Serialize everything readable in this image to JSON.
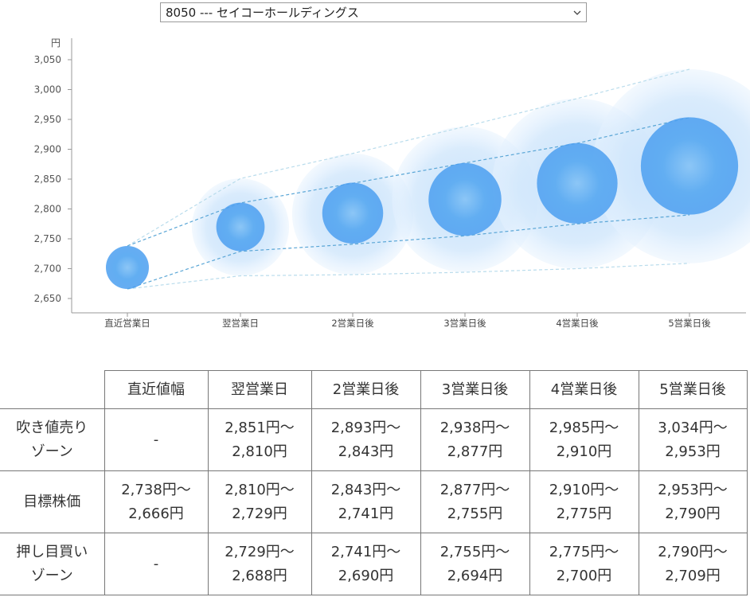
{
  "selector": {
    "selected": "8050 --- セイコーホールディングス",
    "icon": "chevron-down-icon"
  },
  "chart_data": {
    "type": "bubble",
    "ylabel": "円",
    "ylim": [
      2650,
      3050
    ],
    "yticks": [
      "3,050",
      "3,000",
      "2,950",
      "2,900",
      "2,850",
      "2,800",
      "2,750",
      "2,700",
      "2,650"
    ],
    "ytick_values": [
      3050,
      3000,
      2950,
      2900,
      2850,
      2800,
      2750,
      2700,
      2650
    ],
    "categories": [
      "直近営業日",
      "翌営業日",
      "2営業日後",
      "3営業日後",
      "4営業日後",
      "5営業日後"
    ],
    "target_center": [
      2702,
      2770,
      2793,
      2816,
      2843,
      2872
    ],
    "target_upper": [
      2738,
      2810,
      2843,
      2877,
      2910,
      2953
    ],
    "target_lower": [
      2666,
      2729,
      2741,
      2755,
      2775,
      2790
    ],
    "sell_zone_upper": [
      null,
      2851,
      2893,
      2938,
      2985,
      3034
    ],
    "buy_zone_lower": [
      null,
      2688,
      2690,
      2694,
      2700,
      2709
    ],
    "colors": {
      "bubble": "#5aaaf0",
      "halo": "#c8e2fb",
      "dash_inner": "#5aa6d6",
      "dash_outer": "#b9dcec",
      "axis": "#999999"
    }
  },
  "table": {
    "headers": [
      "",
      "直近値幅",
      "翌営業日",
      "2営業日後",
      "3営業日後",
      "4営業日後",
      "5営業日後"
    ],
    "rows": [
      {
        "label": [
          "吹き値売り",
          "ゾーン"
        ],
        "cells": [
          [
            "-"
          ],
          [
            "2,851円～",
            "2,810円"
          ],
          [
            "2,893円～",
            "2,843円"
          ],
          [
            "2,938円～",
            "2,877円"
          ],
          [
            "2,985円～",
            "2,910円"
          ],
          [
            "3,034円～",
            "2,953円"
          ]
        ]
      },
      {
        "label": [
          "目標株価"
        ],
        "cells": [
          [
            "2,738円～",
            "2,666円"
          ],
          [
            "2,810円～",
            "2,729円"
          ],
          [
            "2,843円～",
            "2,741円"
          ],
          [
            "2,877円～",
            "2,755円"
          ],
          [
            "2,910円～",
            "2,775円"
          ],
          [
            "2,953円～",
            "2,790円"
          ]
        ]
      },
      {
        "label": [
          "押し目買い",
          "ゾーン"
        ],
        "cells": [
          [
            "-"
          ],
          [
            "2,729円～",
            "2,688円"
          ],
          [
            "2,741円～",
            "2,690円"
          ],
          [
            "2,755円～",
            "2,694円"
          ],
          [
            "2,775円～",
            "2,700円"
          ],
          [
            "2,790円～",
            "2,709円"
          ]
        ]
      }
    ]
  }
}
